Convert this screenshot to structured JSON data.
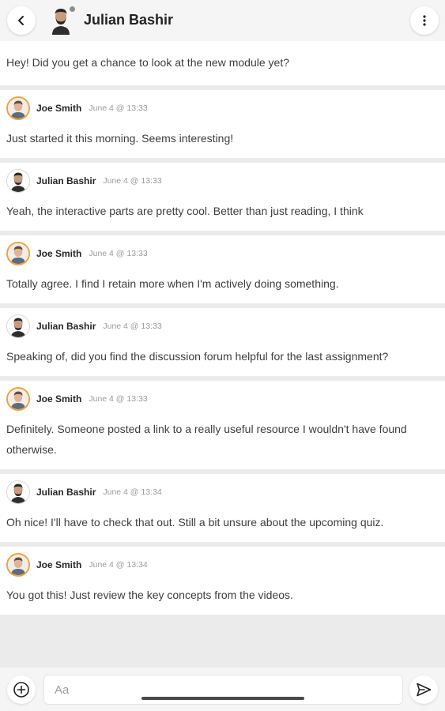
{
  "header": {
    "title": "Julian Bashir",
    "back_icon": "chevron-left-icon",
    "menu_icon": "more-vertical-icon"
  },
  "first_message": "Hey! Did you get a chance to look at the new module yet?",
  "messages": [
    {
      "author": "Joe Smith",
      "time": "June 4 @ 13:33",
      "text": "Just started it this morning. Seems interesting!"
    },
    {
      "author": "Julian Bashir",
      "time": "June 4 @ 13:33",
      "text": "Yeah, the interactive parts are pretty cool. Better than just reading, I think"
    },
    {
      "author": "Joe Smith",
      "time": "June 4 @ 13:33",
      "text": "Totally agree. I find I retain more when I'm actively doing something."
    },
    {
      "author": "Julian Bashir",
      "time": "June 4 @ 13:33",
      "text": "Speaking of, did you find the discussion forum helpful for the last assignment?"
    },
    {
      "author": "Joe Smith",
      "time": "June 4 @ 13:33",
      "text": "Definitely. Someone posted a link to a really useful resource I wouldn't have found otherwise."
    },
    {
      "author": "Julian Bashir",
      "time": "June 4 @ 13:34",
      "text": "Oh nice! I'll have to check that out. Still a bit unsure about the upcoming quiz."
    },
    {
      "author": "Joe Smith",
      "time": "June 4 @ 13:34",
      "text": "You got this! Just review the key concepts from the videos."
    }
  ],
  "composer": {
    "placeholder": "Aa",
    "attach_icon": "add-circle-icon",
    "send_icon": "send-icon"
  },
  "colors": {
    "joe_avatar_ring": "#f0a33a",
    "background": "#ebebeb",
    "card": "#ffffff"
  }
}
